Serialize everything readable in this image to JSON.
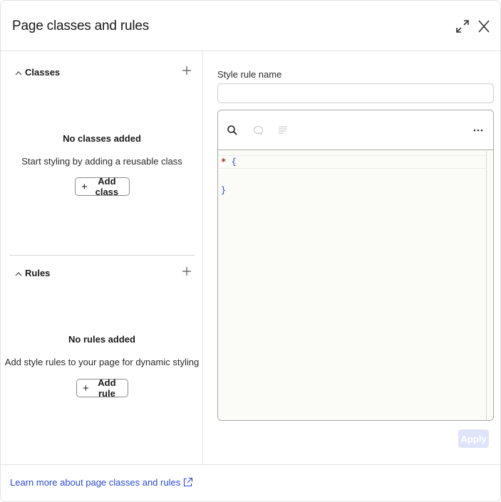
{
  "dialog": {
    "title": "Page classes and rules",
    "icons": {
      "expand": "expand-arrows-icon",
      "close": "close-icon"
    }
  },
  "classes": {
    "header": "Classes",
    "empty_title": "No classes added",
    "empty_desc": "Start styling by adding a reusable class",
    "add_label": "Add class"
  },
  "rules": {
    "header": "Rules",
    "empty_title": "No rules added",
    "empty_desc": "Add style rules to your page for dynamic styling",
    "add_label": "Add rule"
  },
  "style_rule": {
    "name_label": "Style rule name",
    "name_value": "",
    "toolbar_icons": [
      "search-icon",
      "comment-icon",
      "format-icon",
      "more-icon"
    ],
    "code_lines": [
      {
        "selector": "*",
        "open": "{"
      },
      {
        "close": "}"
      }
    ],
    "apply_label": "Apply"
  },
  "footer": {
    "learn_more": "Learn more about page classes and rules"
  },
  "colors": {
    "link": "#2a4bd6",
    "apply_disabled": "#dfe4fb",
    "selector": "#b0271b",
    "brace": "#2c4fd1"
  }
}
